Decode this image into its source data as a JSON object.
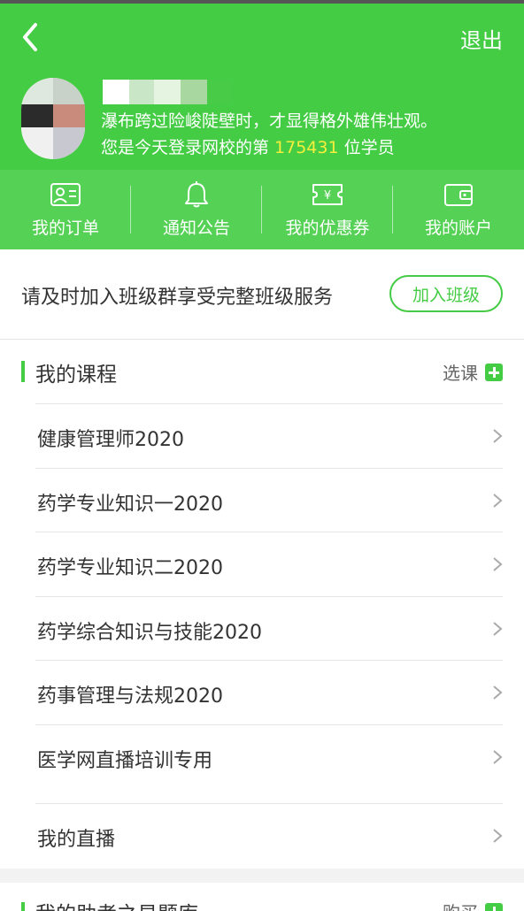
{
  "header": {
    "logout_label": "退出",
    "user": {
      "motto": "瀑布跨过险峻陡壁时，才显得格外雄伟壮观。",
      "rank_prefix": "您是今天登录网校的第 ",
      "rank_number": "175431",
      "rank_suffix": " 位学员"
    }
  },
  "quicknav": {
    "items": [
      {
        "label": "我的订单",
        "icon": "user-card-icon"
      },
      {
        "label": "通知公告",
        "icon": "bell-icon"
      },
      {
        "label": "我的优惠券",
        "icon": "coupon-icon"
      },
      {
        "label": "我的账户",
        "icon": "wallet-icon"
      }
    ]
  },
  "join": {
    "text": "请及时加入班级群享受完整班级服务",
    "button_label": "加入班级"
  },
  "my_courses": {
    "title": "我的课程",
    "select_label": "选课",
    "items": [
      "健康管理师2020",
      "药学专业知识一2020",
      "药学专业知识二2020",
      "药学综合知识与技能2020",
      "药事管理与法规2020",
      "医学网直播培训专用"
    ],
    "live_label": "我的直播"
  },
  "question_bank": {
    "title": "我的助考之易题库",
    "buy_label": "购买"
  },
  "colors": {
    "brand_green": "#44cc44",
    "highlight_yellow": "#f6ee3c"
  }
}
